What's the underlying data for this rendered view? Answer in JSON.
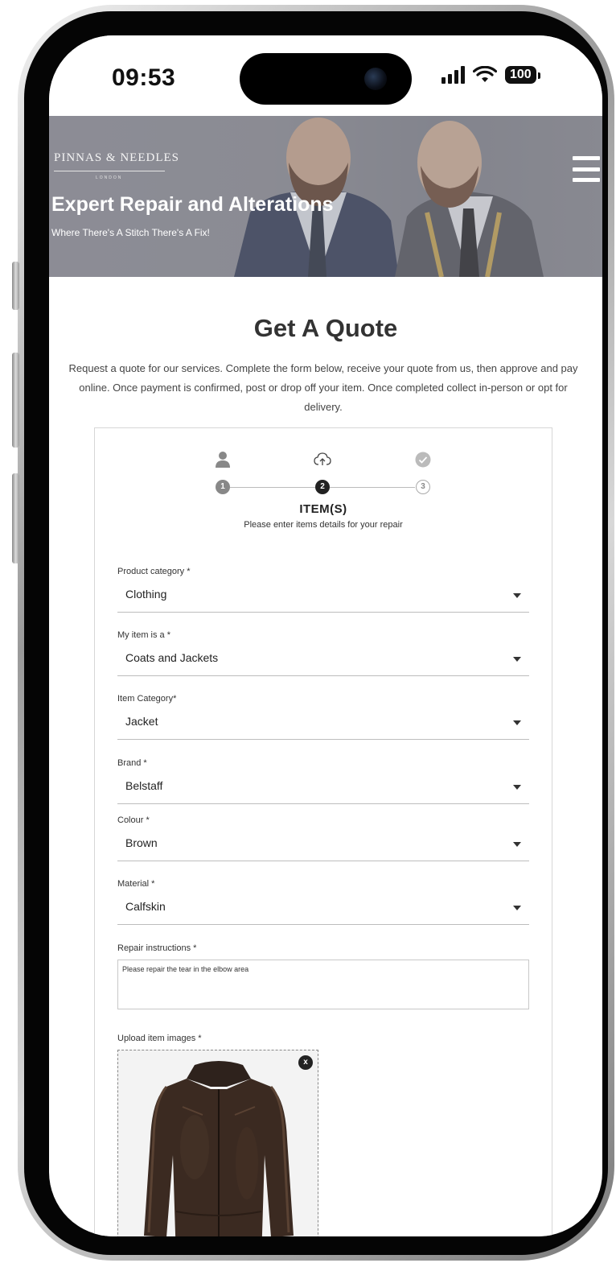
{
  "status_bar": {
    "time": "09:53",
    "battery": "100"
  },
  "header": {
    "logo_text": "PINNAS & NEEDLES",
    "logo_sub": "LONDON",
    "title": "Expert Repair and Alterations",
    "subtitle": "Where There's A Stitch There's A Fix!",
    "menu_icon": "hamburger-icon"
  },
  "main": {
    "title": "Get A Quote",
    "intro": "Request a quote for our services. Complete the form below, receive your quote from us, then approve and pay online. Once payment is confirmed, post or drop off your item. Once completed collect in-person or opt for delivery."
  },
  "stepper": {
    "steps": [
      {
        "number": "1",
        "icon": "user-icon"
      },
      {
        "number": "2",
        "icon": "cloud-upload-icon"
      },
      {
        "number": "3",
        "icon": "check-circle-icon"
      }
    ],
    "active_step": 2
  },
  "form": {
    "section_title": "ITEM(S)",
    "section_subtitle": "Please enter items details for your repair",
    "fields": [
      {
        "label": "Product category *",
        "value": "Clothing"
      },
      {
        "label": "My item is a *",
        "value": "Coats and Jackets"
      },
      {
        "label": "Item Category*",
        "value": "Jacket"
      },
      {
        "label": "Brand *",
        "value": "Belstaff"
      },
      {
        "label": "Colour *",
        "value": "Brown"
      },
      {
        "label": "Material *",
        "value": "Calfskin"
      }
    ],
    "instructions_label": "Repair instructions *",
    "instructions_value": "Please repair the tear in the elbow area",
    "upload_label": "Upload item images *",
    "remove_label": "x"
  },
  "colors": {
    "hero_overlay": "#8a8b93",
    "text_dark": "#333333",
    "accent": "#222222"
  }
}
